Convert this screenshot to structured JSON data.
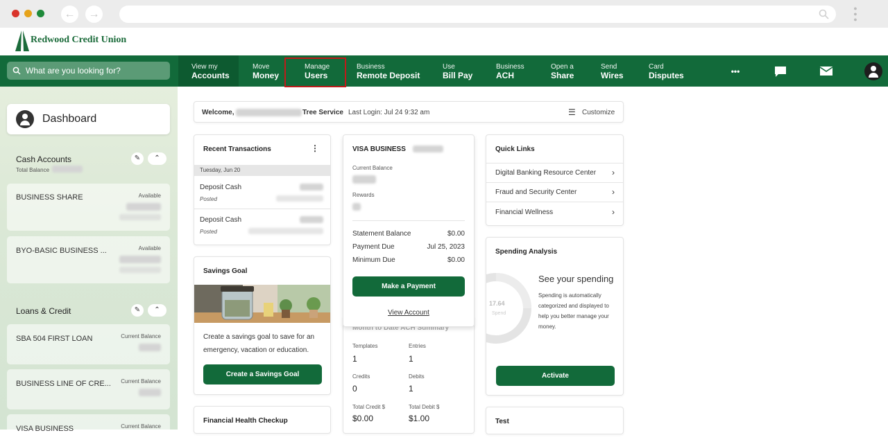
{
  "header": {
    "logo_text": "Redwood Credit Union"
  },
  "search": {
    "placeholder": "What are you looking for?"
  },
  "nav": {
    "items": [
      {
        "l1": "View my",
        "l2": "Accounts"
      },
      {
        "l1": "Move",
        "l2": "Money"
      },
      {
        "l1": "Manage",
        "l2": "Users"
      },
      {
        "l1": "Business",
        "l2": "Remote Deposit"
      },
      {
        "l1": "Use",
        "l2": "Bill Pay"
      },
      {
        "l1": "Business",
        "l2": "ACH"
      },
      {
        "l1": "Open a",
        "l2": "Share"
      },
      {
        "l1": "Send",
        "l2": "Wires"
      },
      {
        "l1": "Card",
        "l2": "Disputes"
      }
    ],
    "more_label": "•••"
  },
  "sidebar": {
    "dashboard_label": "Dashboard",
    "cash": {
      "title": "Cash Accounts",
      "sub": "Total Balance",
      "accounts": [
        {
          "name": "BUSINESS SHARE",
          "tag": "Available"
        },
        {
          "name": "BYO-BASIC BUSINESS ...",
          "tag": "Available"
        }
      ]
    },
    "loans": {
      "title": "Loans & Credit",
      "accounts": [
        {
          "name": "SBA 504 FIRST LOAN",
          "tag": "Current Balance"
        },
        {
          "name": "BUSINESS LINE OF CRE...",
          "tag": "Current Balance"
        },
        {
          "name": "VISA BUSINESS",
          "tag": "Current Balance"
        }
      ]
    }
  },
  "welcome": {
    "prefix": "Welcome,",
    "name_suffix": "Tree Service",
    "last_login": "Last Login: Jul 24 9:32 am",
    "customize": "Customize"
  },
  "recent": {
    "title": "Recent Transactions",
    "date": "Tuesday, Jun 20",
    "items": [
      {
        "name": "Deposit Cash",
        "status": "Posted"
      },
      {
        "name": "Deposit Cash",
        "status": "Posted"
      }
    ]
  },
  "savings": {
    "title": "Savings Goal",
    "text": "Create a savings goal to save for an emergency, vacation or education.",
    "button": "Create a Savings Goal"
  },
  "health": {
    "title": "Financial Health Checkup"
  },
  "visa": {
    "title": "VISA BUSINESS",
    "current_balance": "Current Balance",
    "rewards": "Rewards",
    "rows": [
      {
        "label": "Statement Balance",
        "value": "$0.00"
      },
      {
        "label": "Payment Due",
        "value": "Jul 25, 2023"
      },
      {
        "label": "Minimum Due",
        "value": "$0.00"
      }
    ],
    "button": "Make a Payment",
    "view": "View Account"
  },
  "ach": {
    "title": "Month to Date ACH Summary",
    "cells": [
      {
        "label": "Templates",
        "value": "1"
      },
      {
        "label": "Entries",
        "value": "1"
      },
      {
        "label": "Credits",
        "value": "0"
      },
      {
        "label": "Debits",
        "value": "1"
      },
      {
        "label": "Total Credit $",
        "value": "$0.00"
      },
      {
        "label": "Total Debit $",
        "value": "$1.00"
      }
    ]
  },
  "quick": {
    "title": "Quick Links",
    "links": [
      "Digital Banking Resource Center",
      "Fraud and Security Center",
      "Financial Wellness"
    ]
  },
  "spending": {
    "title": "Spending Analysis",
    "heading": "See your spending",
    "text": "Spending is automatically categorized and displayed to help you better manage your money.",
    "donut_value": "17.64",
    "donut_label": "Spend",
    "button": "Activate"
  },
  "test": {
    "title": "Test"
  },
  "colors": {
    "brand_green": "#126a3a",
    "highlight_red": "#c01a1a"
  }
}
